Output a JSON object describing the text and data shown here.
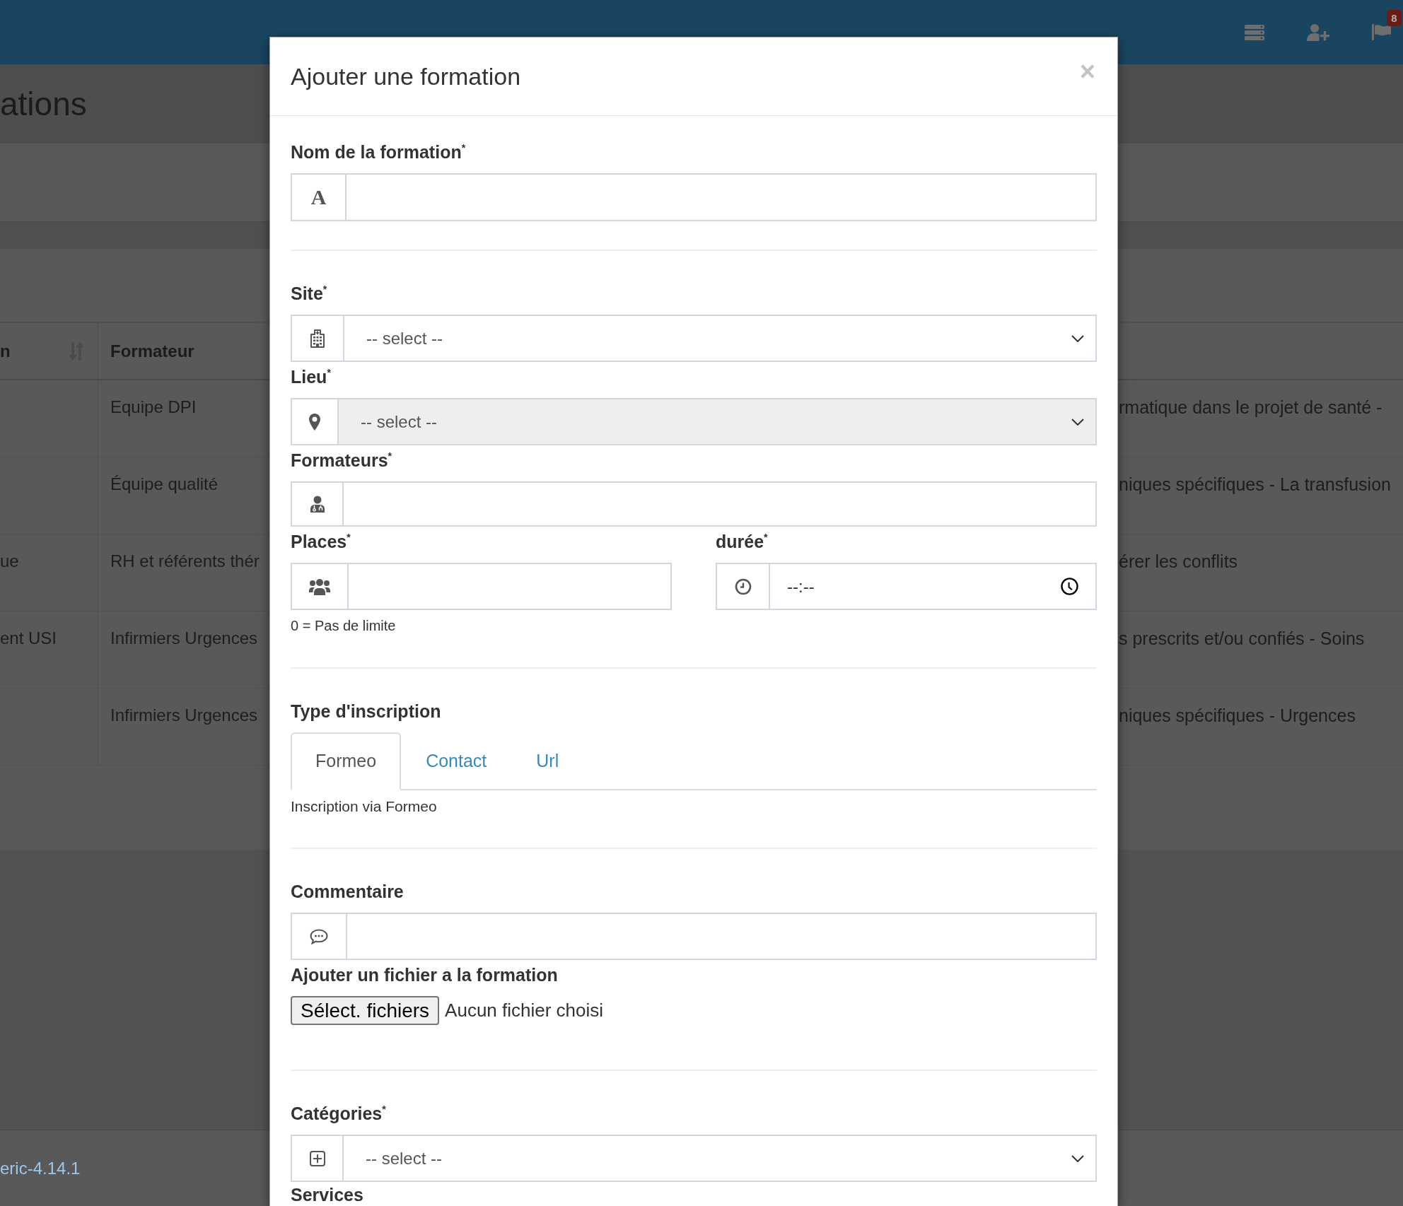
{
  "navbar": {
    "notification_badge": "8"
  },
  "page": {
    "title": "ations",
    "table": {
      "columns": [
        {
          "label": "n",
          "sortable": true
        },
        {
          "label": "Formateur",
          "sortable": false
        }
      ],
      "rows": [
        {
          "column_2": "Equipe DPI",
          "column_3": "rmatique dans le projet de santé -"
        },
        {
          "column_2": "Équipe qualité",
          "column_3": "niques spécifiques - La transfusion"
        },
        {
          "column_1": "ue",
          "column_2": "RH et référents thér",
          "column_3": "érer les conflits"
        },
        {
          "column_1": "ent USI",
          "column_2": "Infirmiers Urgences",
          "column_3": "s prescrits et/ou confiés - Soins"
        },
        {
          "column_2": "Infirmiers Urgences",
          "column_3": "niques spécifiques - Urgences"
        }
      ]
    },
    "footer_link": "eric-4.14.1"
  },
  "modal": {
    "title": "Ajouter une formation",
    "close_button": "×",
    "form": {
      "name": {
        "label": "Nom de la formation$^{*}$",
        "addon": "A"
      },
      "site": {
        "label": "Site$^{*}$",
        "value": "-- select --",
        "disabled": false
      },
      "lieu": {
        "label": "Lieu$^{*}$",
        "value": "-- select --",
        "disabled": true
      },
      "formateurs": {
        "label": "Formateurs$^{*}$"
      },
      "places": {
        "label": "Places$^{*}$",
        "help": "0 = Pas de limite"
      },
      "duree": {
        "label": "durée$^{*}$",
        "placeholder": "--:--"
      },
      "inscription": {
        "label": "Type d'inscription",
        "tabs": [
          {
            "label": "Formeo",
            "selected": true
          },
          {
            "label": "Contact",
            "selected": false
          },
          {
            "label": "Url",
            "selected": false
          }
        ],
        "description": "Inscription via Formeo"
      },
      "commentaire": {
        "label": "Commentaire"
      },
      "fichier": {
        "label": "Ajouter un fichier a la formation",
        "button": "Sélect. fichiers",
        "status": "Aucun fichier choisi"
      },
      "categories": {
        "label": "Catégories$^{*}$",
        "value": "-- select --",
        "disabled": false
      },
      "services": {
        "label": "Services"
      }
    }
  }
}
